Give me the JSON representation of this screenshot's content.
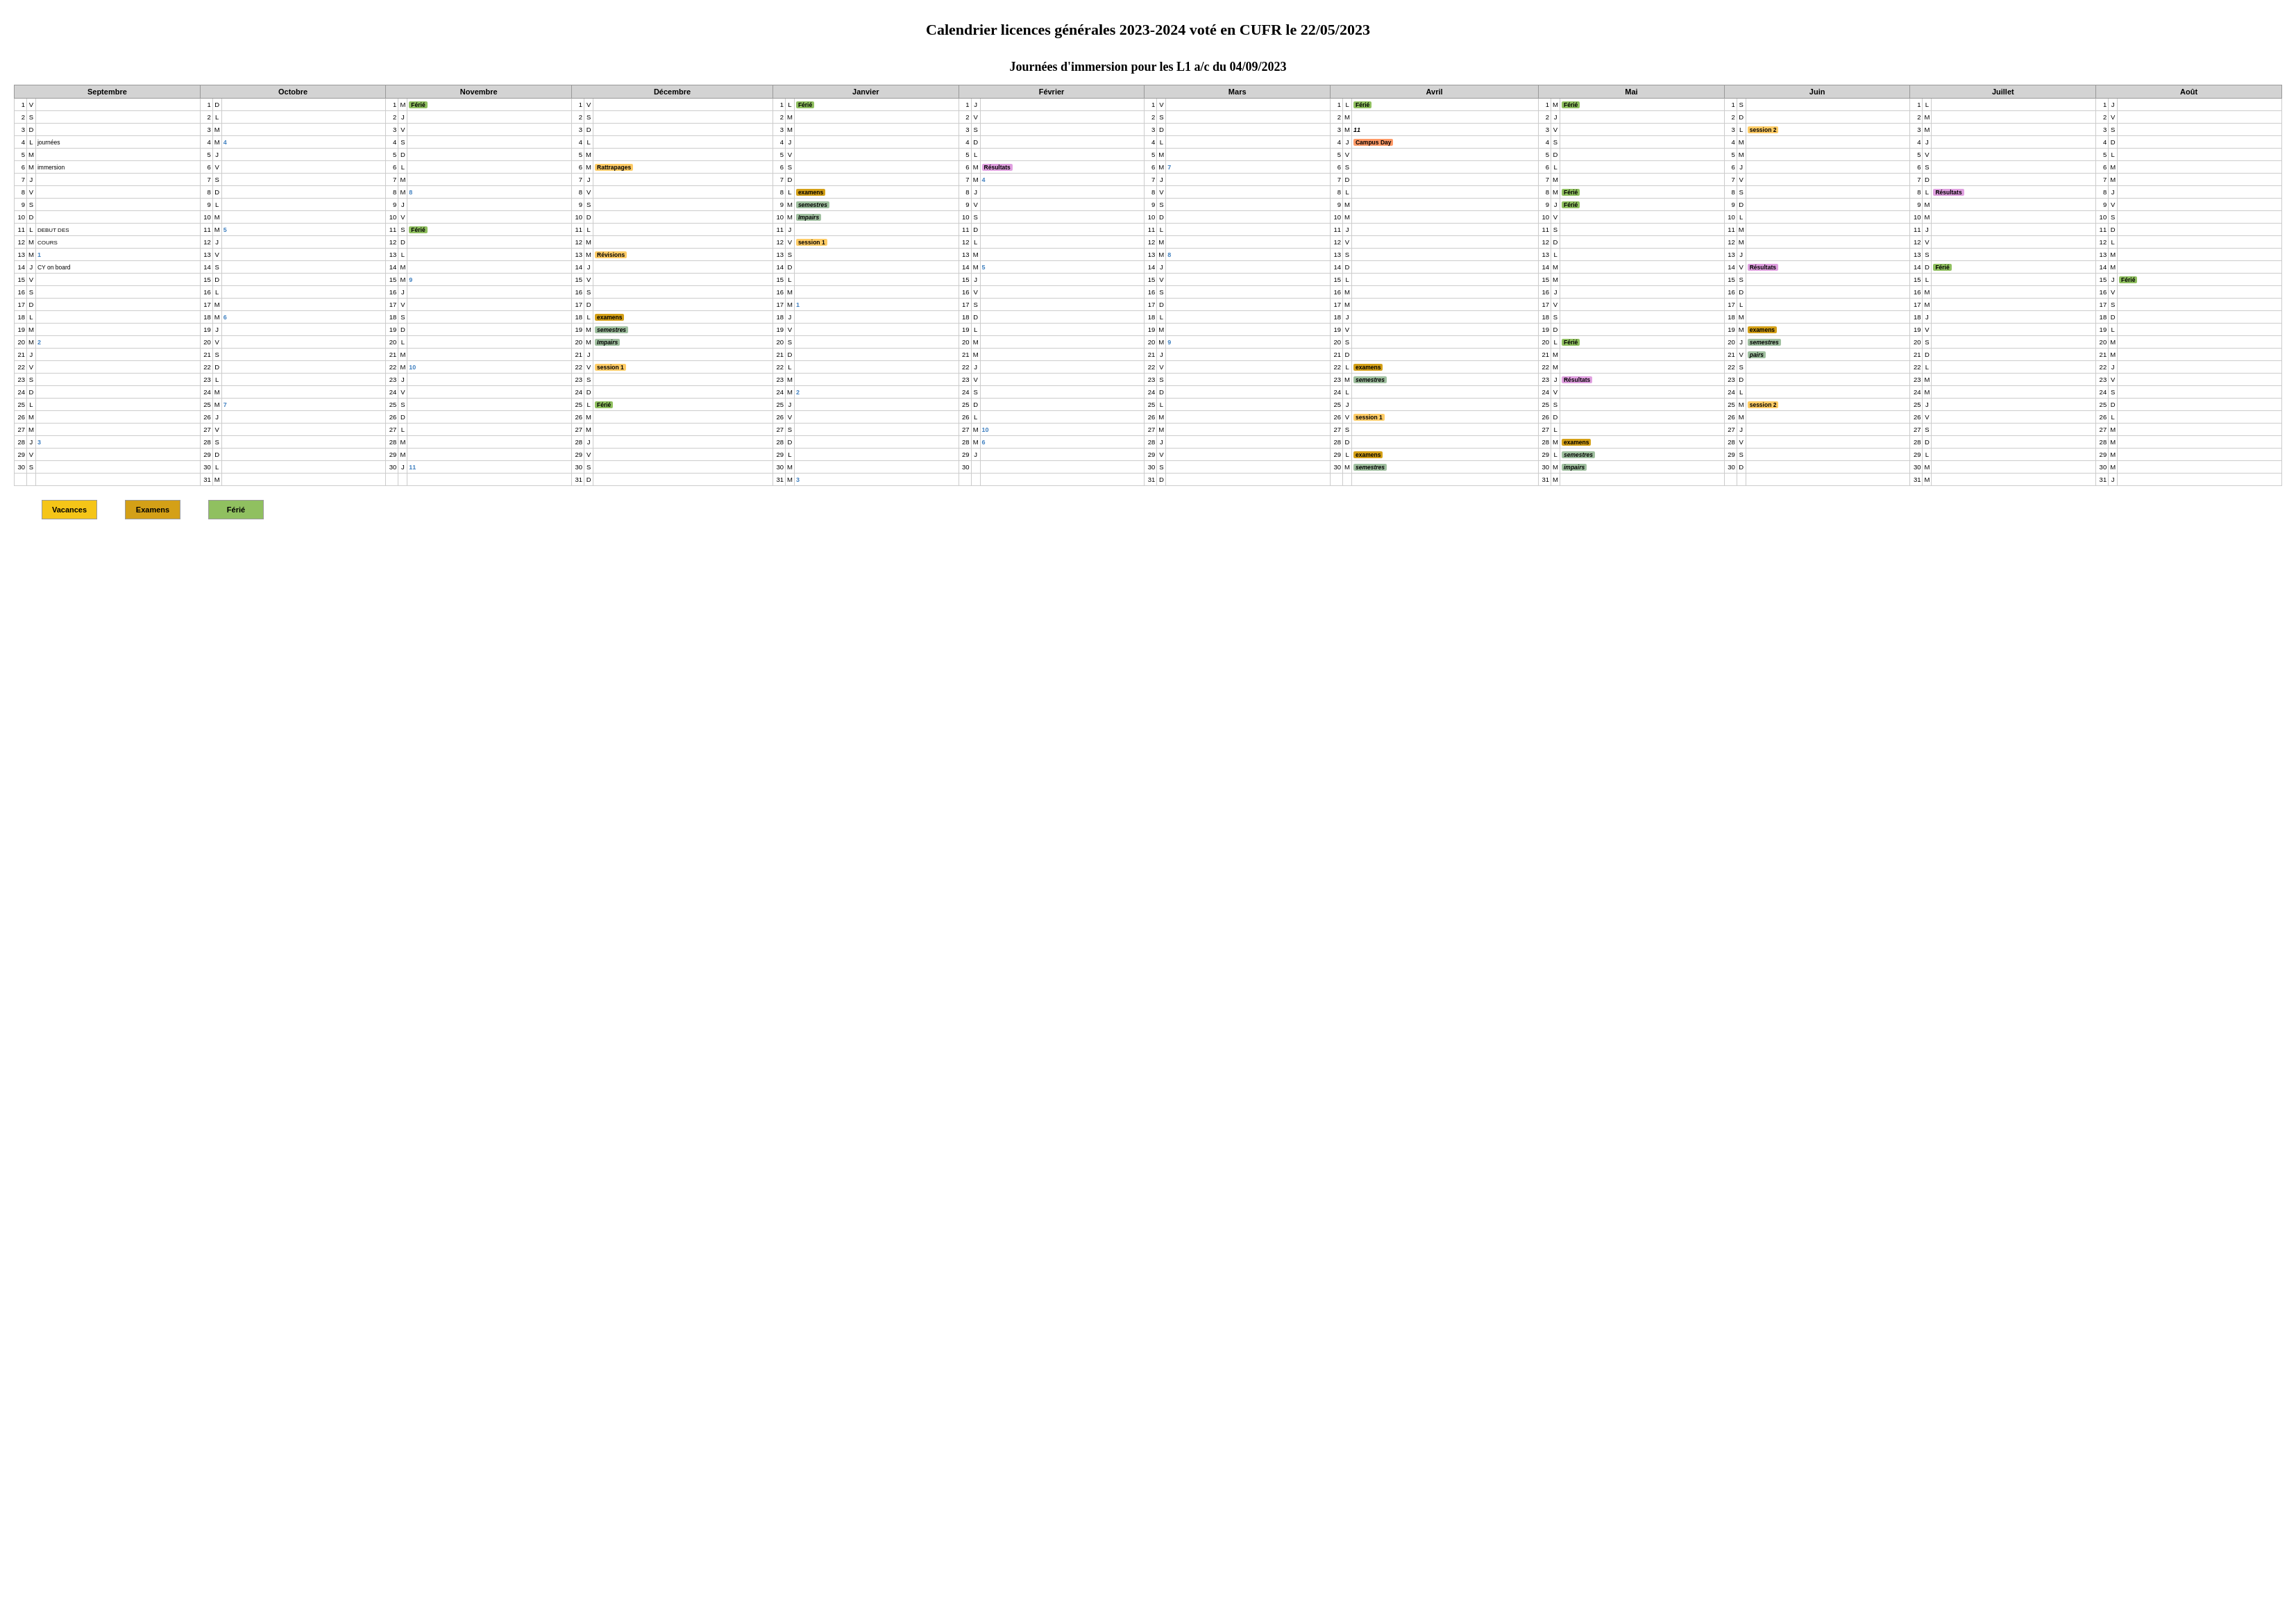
{
  "title": "Calendrier licences générales 2023-2024 voté en CUFR le 22/05/2023",
  "subtitle": "Journées d'immersion pour les L1 a/c du 04/09/2023",
  "legend": [
    {
      "label": "Vacances",
      "class": "vacances"
    },
    {
      "label": "Examens",
      "class": "examens"
    },
    {
      "label": "Férié",
      "class": "ferie"
    }
  ],
  "months": [
    "Septembre",
    "Octobre",
    "Novembre",
    "Décembre",
    "Janvier",
    "Février",
    "Mars",
    "Avril",
    "Mai",
    "Juin",
    "Juillet",
    "Août"
  ]
}
